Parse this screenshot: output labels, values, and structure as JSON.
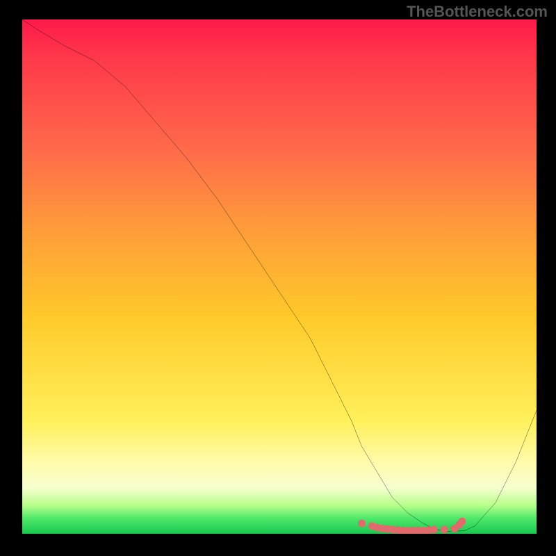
{
  "watermark": "TheBottleneck.com",
  "chart_data": {
    "type": "line",
    "title": "",
    "xlabel": "",
    "ylabel": "",
    "xlim": [
      0,
      100
    ],
    "ylim": [
      0,
      100
    ],
    "grid": false,
    "series": [
      {
        "name": "curve",
        "x": [
          0,
          3,
          8,
          14,
          20,
          26,
          32,
          38,
          44,
          50,
          56,
          60,
          64,
          66,
          69,
          72,
          75,
          78,
          80,
          82,
          84,
          86,
          88,
          92,
          96,
          100
        ],
        "y": [
          100,
          98,
          95,
          92,
          87,
          80,
          73,
          65,
          56,
          47,
          38,
          30,
          22,
          17,
          12,
          7,
          4,
          2,
          1,
          0.5,
          0.5,
          0.6,
          1.5,
          6,
          14,
          24
        ]
      }
    ],
    "markers": {
      "name": "trough-dots",
      "color": "#e36a6a",
      "x": [
        66,
        68,
        69,
        70,
        71,
        72,
        73,
        74,
        75,
        76,
        77,
        78,
        79,
        80,
        82,
        84,
        85,
        85.5
      ],
      "y": [
        2.0,
        1.5,
        1.2,
        1.0,
        0.9,
        0.8,
        0.7,
        0.6,
        0.6,
        0.6,
        0.6,
        0.6,
        0.7,
        0.8,
        0.8,
        1.0,
        1.8,
        2.4
      ]
    },
    "background_gradient_stops": [
      {
        "pos": 0.0,
        "color": "#ff1a4a"
      },
      {
        "pos": 0.25,
        "color": "#ff6a4a"
      },
      {
        "pos": 0.58,
        "color": "#ffca2a"
      },
      {
        "pos": 0.86,
        "color": "#fffbaa"
      },
      {
        "pos": 0.97,
        "color": "#4fe86a"
      },
      {
        "pos": 1.0,
        "color": "#18c850"
      }
    ]
  }
}
